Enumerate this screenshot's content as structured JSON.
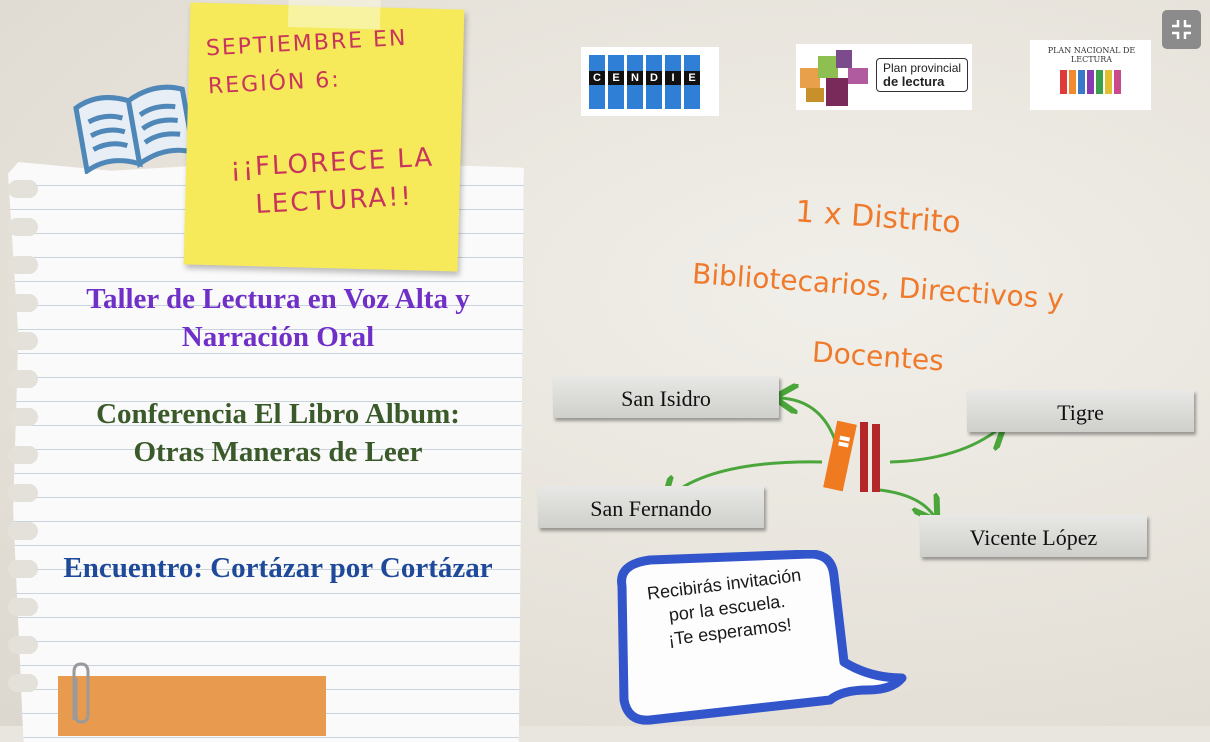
{
  "sticky_note": {
    "title": "Septiembre en Región 6:",
    "motto": "¡¡Florece la lectura!!"
  },
  "activities": [
    "Taller de Lectura en Voz Alta y Narración Oral",
    "Conferencia El Libro Album: Otras Maneras de Leer",
    "Encuentro: Cortázar por Cortázar"
  ],
  "logos": {
    "cendie_letters": [
      "C",
      "E",
      "N",
      "D",
      "I",
      "E"
    ],
    "plan_provincial_line1": "Plan provincial",
    "plan_provincial_line2": "de lectura",
    "plan_nacional": "PLAN NACIONAL DE LECTURA"
  },
  "audience": {
    "line1": "1 x Distrito",
    "line2": "Bibliotecarios, Directivos y",
    "line3": "Docentes"
  },
  "districts": {
    "san_isidro": "San Isidro",
    "san_fernando": "San Fernando",
    "tigre": "Tigre",
    "vicente_lopez": "Vicente López"
  },
  "bubble": {
    "line1": "Recibirás invitación",
    "line2": "por la escuela.",
    "line3": "¡Te esperamos!"
  },
  "colors": {
    "sticky_text": "#c8345b",
    "handwriting": "#f07a2c",
    "bubble_border": "#3355cc",
    "arrow": "#4aa63a"
  },
  "icons": {
    "fullscreen": "exit-fullscreen-icon",
    "book": "open-book-icon",
    "clip": "paperclip-icon",
    "books_center": "books-icon"
  }
}
